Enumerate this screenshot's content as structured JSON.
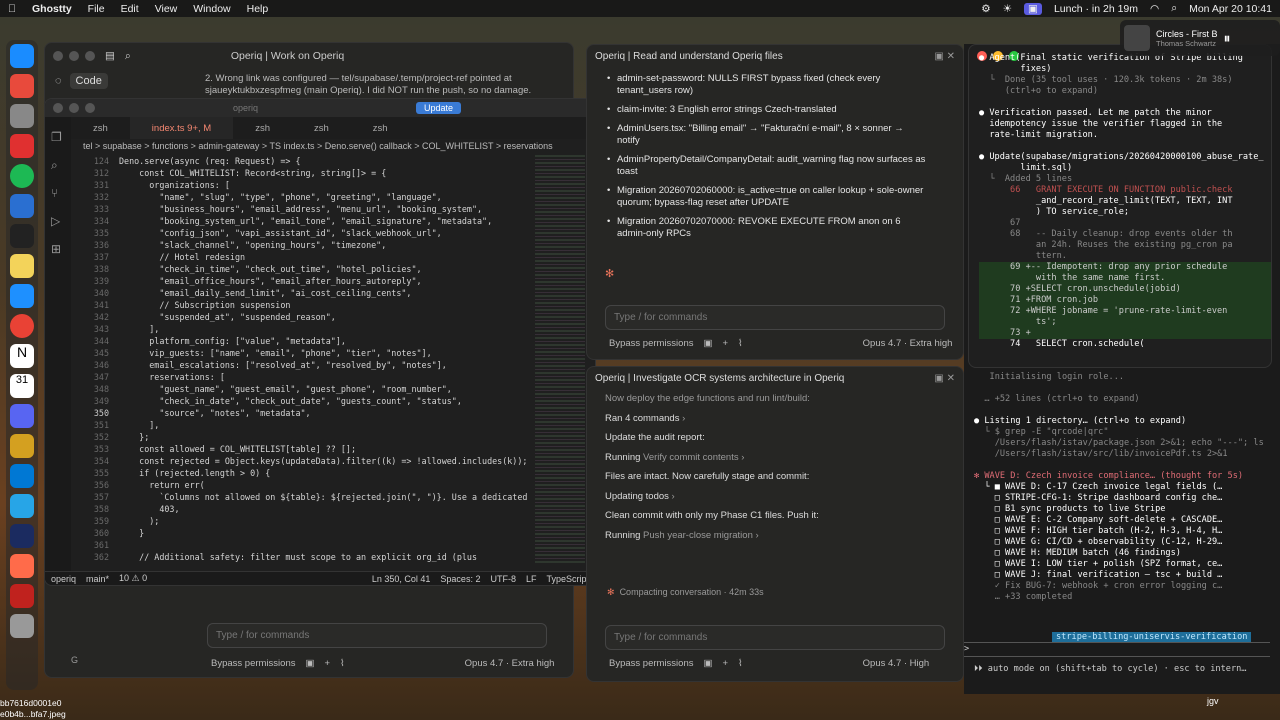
{
  "menubar": {
    "app": "Ghostty",
    "menus": [
      "File",
      "Edit",
      "View",
      "Window",
      "Help"
    ],
    "lunch": "Lunch · in 2h 19m",
    "datetime": "Mon Apr 20  10:41"
  },
  "now_playing": {
    "title": "Circles - First B",
    "artist": "Thomas Schwartz"
  },
  "left": {
    "title": "Operiq | Work on Operiq",
    "code_chip": "Code",
    "notice": "2. Wrong link was configured — tel/supabase/.temp/project-ref pointed at sjaueyktukbxzespfmeg (main Operiq). I did NOT run the push, so no damage.",
    "input_placeholder": "Type / for commands",
    "bypass": "Bypass permissions",
    "model": "Opus 4.7 · Extra high",
    "bottom_g": "G"
  },
  "vscode": {
    "search": "operiq",
    "update": "Update",
    "tabs": [
      "zsh",
      "index.ts 9+, M",
      "zsh",
      "zsh",
      "zsh"
    ],
    "breadcrumb": "tel > supabase > functions > admin-gateway > TS index.ts > Deno.serve() callback > COL_WHITELIST > reservations",
    "status": {
      "branch": "operiq",
      "main": "main*",
      "problems": "10 ⚠ 0",
      "position": "Ln 350, Col 41",
      "spaces": "Spaces: 2",
      "encoding": "UTF-8",
      "eol": "LF",
      "lang": "TypeScript"
    },
    "lines": [
      {
        "n": "124",
        "t": "Deno.serve(async (req: Request) => {"
      },
      {
        "n": "312",
        "t": "    const COL_WHITELIST: Record<string, string[]> = {"
      },
      {
        "n": "331",
        "t": "      organizations: ["
      },
      {
        "n": "332",
        "t": "        \"name\", \"slug\", \"type\", \"phone\", \"greeting\", \"language\","
      },
      {
        "n": "333",
        "t": "        \"business_hours\", \"email_address\", \"menu_url\", \"booking_system\","
      },
      {
        "n": "334",
        "t": "        \"booking_system_url\", \"email_tone\", \"email_signature\", \"metadata\","
      },
      {
        "n": "335",
        "t": "        \"config_json\", \"vapi_assistant_id\", \"slack_webhook_url\","
      },
      {
        "n": "336",
        "t": "        \"slack_channel\", \"opening_hours\", \"timezone\","
      },
      {
        "n": "337",
        "t": "        // Hotel redesign"
      },
      {
        "n": "338",
        "t": "        \"check_in_time\", \"check_out_time\", \"hotel_policies\","
      },
      {
        "n": "339",
        "t": "        \"email_office_hours\", \"email_after_hours_autoreply\","
      },
      {
        "n": "340",
        "t": "        \"email_daily_send_limit\", \"ai_cost_ceiling_cents\","
      },
      {
        "n": "341",
        "t": "        // Subscription suspension"
      },
      {
        "n": "342",
        "t": "        \"suspended_at\", \"suspended_reason\","
      },
      {
        "n": "343",
        "t": "      ],"
      },
      {
        "n": "344",
        "t": "      platform_config: [\"value\", \"metadata\"],"
      },
      {
        "n": "345",
        "t": "      vip_guests: [\"name\", \"email\", \"phone\", \"tier\", \"notes\"],"
      },
      {
        "n": "346",
        "t": "      email_escalations: [\"resolved_at\", \"resolved_by\", \"notes\"],"
      },
      {
        "n": "347",
        "t": "      reservations: ["
      },
      {
        "n": "348",
        "t": "        \"guest_name\", \"guest_email\", \"guest_phone\", \"room_number\","
      },
      {
        "n": "349",
        "t": "        \"check_in_date\", \"check_out_date\", \"guests_count\", \"status\","
      },
      {
        "n": "350",
        "t": "        \"source\", \"notes\", \"metadata\","
      },
      {
        "n": "351",
        "t": "      ],"
      },
      {
        "n": "352",
        "t": "    };"
      },
      {
        "n": "353",
        "t": "    const allowed = COL_WHITELIST[table] ?? [];"
      },
      {
        "n": "354",
        "t": "    const rejected = Object.keys(updateData).filter((k) => !allowed.includes(k));"
      },
      {
        "n": "355",
        "t": "    if (rejected.length > 0) {"
      },
      {
        "n": "356",
        "t": "      return err("
      },
      {
        "n": "357",
        "t": "        `Columns not allowed on ${table}: ${rejected.join(\", \")}. Use a dedicated"
      },
      {
        "n": "358",
        "t": "        403,"
      },
      {
        "n": "359",
        "t": "      );"
      },
      {
        "n": "360",
        "t": "    }"
      },
      {
        "n": "361",
        "t": ""
      },
      {
        "n": "362",
        "t": "    // Additional safety: filter must scope to an explicit org_id (plus"
      }
    ]
  },
  "midtop": {
    "title": "Operiq | Read and understand Operiq files",
    "bullets": [
      "admin-set-password: NULLS FIRST bypass fixed (check every tenant_users row)",
      "claim-invite: 3 English error strings Czech-translated",
      "AdminUsers.tsx: \"Billing email\" → \"Fakturační e-mail\", 8 × sonner → notify",
      "AdminPropertyDetail/CompanyDetail: audit_warning flag now surfaces as toast",
      "Migration 20260702060000: is_active=true on caller lookup + sole-owner quorum; bypass-flag reset after UPDATE",
      "Migration 20260702070000: REVOKE EXECUTE FROM anon on 6 admin-only RPCs"
    ],
    "input_placeholder": "Type / for commands",
    "bypass": "Bypass permissions",
    "model": "Opus 4.7 · Extra high"
  },
  "midbot": {
    "title": "Operiq | Investigate OCR systems architecture in Operiq",
    "lines": [
      {
        "a": "Now deploy the edge functions and run lint/build:",
        "b": ""
      },
      {
        "a": "Ran 4 commands",
        "b": " ›"
      },
      {
        "a": "Update the audit report:",
        "b": ""
      },
      {
        "a": "Running ",
        "b": "Verify commit contents ›"
      },
      {
        "a": "Files are intact. Now carefully stage and commit:",
        "b": ""
      },
      {
        "a": "Updating todos",
        "b": " ›"
      },
      {
        "a": "Clean commit with only my Phase C1 files. Push it:",
        "b": ""
      },
      {
        "a": "Running ",
        "b": "Push year-close migration ›"
      }
    ],
    "compacting": "Compacting conversation · 42m 33s",
    "input_placeholder": "Type / for commands",
    "bypass": "Bypass permissions",
    "model": "Opus 4.7 · High"
  },
  "popup": {
    "lines": [
      {
        "c": "w",
        "t": "● Agent(Final static verification of Stripe billing"
      },
      {
        "c": "w",
        "t": "        fixes)"
      },
      {
        "c": "gr",
        "t": "  └  Done (35 tool uses · 120.3k tokens · 2m 38s)"
      },
      {
        "c": "gr",
        "t": "     (ctrl+o to expand)"
      },
      {
        "c": "",
        "t": ""
      },
      {
        "c": "w",
        "t": "● Verification passed. Let me patch the minor"
      },
      {
        "c": "w",
        "t": "  idempotency issue the verifier flagged in the"
      },
      {
        "c": "w",
        "t": "  rate-limit migration."
      },
      {
        "c": "",
        "t": ""
      },
      {
        "c": "w",
        "t": "● Update(supabase/migrations/20260420000100_abuse_rate_"
      },
      {
        "c": "w",
        "t": "        limit.sql)"
      },
      {
        "c": "gr",
        "t": "  └  Added 5 lines"
      },
      {
        "c": "del",
        "t": "      66   GRANT EXECUTE ON FUNCTION public.check"
      },
      {
        "c": "w",
        "t": "           _and_record_rate_limit(TEXT, TEXT, INT"
      },
      {
        "c": "w",
        "t": "           ) TO service_role;"
      },
      {
        "c": "gr",
        "t": "      67"
      },
      {
        "c": "gr",
        "t": "      68   -- Daily cleanup: drop events older th"
      },
      {
        "c": "gr",
        "t": "           an 24h. Reuses the existing pg_cron pa"
      },
      {
        "c": "gr",
        "t": "           ttern."
      },
      {
        "c": "add",
        "t": "      69 +-- Idempotent: drop any prior schedule"
      },
      {
        "c": "add",
        "t": "           with the same name first."
      },
      {
        "c": "add",
        "t": "      70 +SELECT cron.unschedule(jobid)"
      },
      {
        "c": "add",
        "t": "      71 +FROM cron.job"
      },
      {
        "c": "add",
        "t": "      72 +WHERE jobname = 'prune-rate-limit-even"
      },
      {
        "c": "add",
        "t": "           ts';"
      },
      {
        "c": "add",
        "t": "      73 +"
      },
      {
        "c": "w",
        "t": "      74   SELECT cron.schedule("
      }
    ]
  },
  "terminal": {
    "lines": [
      {
        "c": "gr",
        "t": "   Initialising login role..."
      },
      {
        "c": "gr",
        "t": ""
      },
      {
        "c": "gr",
        "t": "  … +52 lines (ctrl+o to expand)"
      },
      {
        "c": "",
        "t": ""
      },
      {
        "c": "w",
        "t": "● Listing 1 directory… (ctrl+o to expand)"
      },
      {
        "c": "gr",
        "t": "  └ $ grep -E \"qrcode|qrc\""
      },
      {
        "c": "gr",
        "t": "    /Users/flash/istav/package.json 2>&1; echo \"---\"; ls"
      },
      {
        "c": "gr",
        "t": "    /Users/flash/istav/src/lib/invoicePdf.ts 2>&1"
      },
      {
        "c": "",
        "t": ""
      },
      {
        "c": "rd",
        "t": "✻ WAVE D: Czech invoice compliance… (thought for 5s)"
      },
      {
        "c": "w",
        "t": "  └ ■ WAVE D: C-17 Czech invoice legal fields (…"
      },
      {
        "c": "w",
        "t": "    □ STRIPE-CFG-1: Stripe dashboard config che…"
      },
      {
        "c": "w",
        "t": "    □ B1 sync products to live Stripe"
      },
      {
        "c": "w",
        "t": "    □ WAVE E: C-2 Company soft-delete + CASCADE…"
      },
      {
        "c": "w",
        "t": "    □ WAVE F: HIGH tier batch (H-2, H-3, H-4, H…"
      },
      {
        "c": "w",
        "t": "    □ WAVE G: CI/CD + observability (C-12, H-29…"
      },
      {
        "c": "w",
        "t": "    □ WAVE H: MEDIUM batch (46 findings)"
      },
      {
        "c": "w",
        "t": "    □ WAVE I: LOW tier + polish (SPZ format, ce…"
      },
      {
        "c": "w",
        "t": "    □ WAVE J: final verification — tsc + build …"
      },
      {
        "c": "gr",
        "t": "    ✓ Fix BUG-7: webhook + cron error logging c…"
      },
      {
        "c": "gr",
        "t": "    … +33 completed"
      }
    ],
    "status_badge": "stripe-billing-uniservis-verification",
    "prompt": ">",
    "automode": "⏵⏵ auto mode on (shift+tab to cycle) · esc to intern…"
  },
  "desktop_labels": [
    "bb7616d0001e0",
    "e0b4b...bfa7.jpeg"
  ],
  "bottom_right_label": "jgv"
}
